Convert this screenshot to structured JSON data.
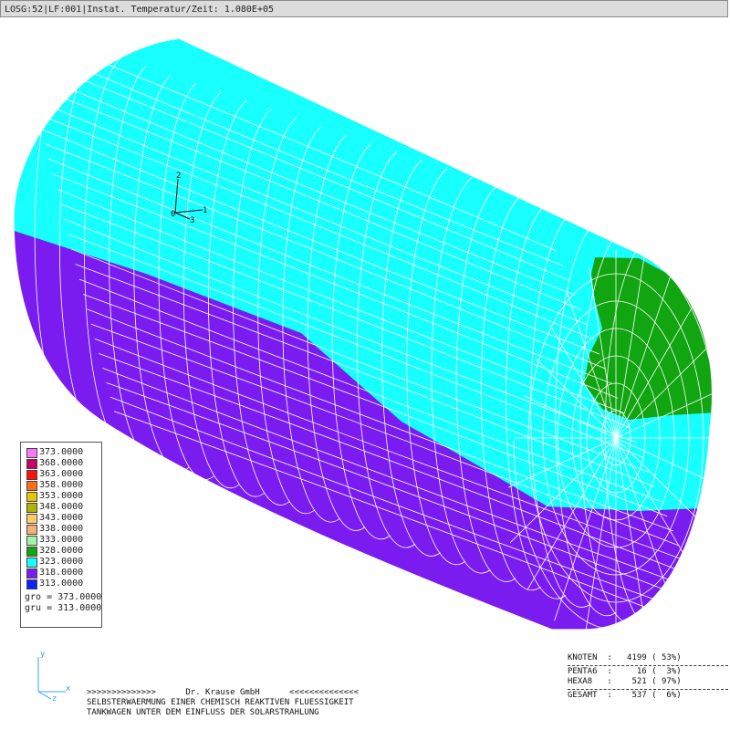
{
  "title_bar": {
    "text": "LOSG:52|LF:001|Instat. Temperatur/Zeit: 1.080E+05"
  },
  "colors": {
    "cyan_region": "#17ffff",
    "violet_region": "#7a1cf0",
    "green_region": "#11a511",
    "mesh_line": "#ffffff",
    "titlebar_bg": "#dcdcdc"
  },
  "legend": {
    "entries": [
      {
        "label": "373.0000",
        "color": "#ff77ff"
      },
      {
        "label": "368.0000",
        "color": "#c8006a"
      },
      {
        "label": "363.0000",
        "color": "#ff1010"
      },
      {
        "label": "358.0000",
        "color": "#ff6f1a"
      },
      {
        "label": "353.0000",
        "color": "#e2c800"
      },
      {
        "label": "348.0000",
        "color": "#b4b400"
      },
      {
        "label": "343.0000",
        "color": "#ffcc66"
      },
      {
        "label": "338.0000",
        "color": "#f5b07a"
      },
      {
        "label": "333.0000",
        "color": "#a2f5a2"
      },
      {
        "label": "328.0000",
        "color": "#11a511"
      },
      {
        "label": "323.0000",
        "color": "#17ffff"
      },
      {
        "label": "318.0000",
        "color": "#7a1cf0"
      },
      {
        "label": "313.0000",
        "color": "#1020ff"
      }
    ],
    "gro": "gro = 373.0000",
    "gru": "gru = 313.0000"
  },
  "model_triad": {
    "axis1": "1",
    "axis2": "2",
    "axis3": "3",
    "origin": "0"
  },
  "screen_triad": {
    "y": "y",
    "x": "x",
    "z": "z"
  },
  "footer": {
    "line1": ">>>>>>>>>>>>>>      Dr. Krause GmbH      <<<<<<<<<<<<<<",
    "line2": "SELBSTERWAERMUNG EINER CHEMISCH REAKTIVEN FLUESSIGKEIT",
    "line3": "TANKWAGEN UNTER DEM EINFLUSS DER SOLARSTRAHLUNG"
  },
  "stats": {
    "knoten": "KNOTEN  :   4199 ( 53%)",
    "penta": "PENTA6  :     16 (  3%)",
    "hexa": "HEXA8   :    521 ( 97%)",
    "gesamt": "GESAMT  :    537 (  6%)"
  }
}
